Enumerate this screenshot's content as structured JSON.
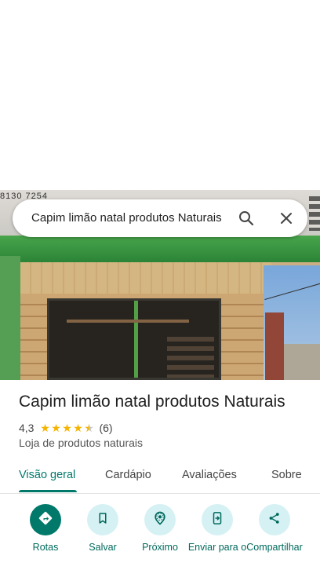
{
  "photo": {
    "sign_partial_text": "8130 7254"
  },
  "search": {
    "query": "Capim limão natal produtos Naturais"
  },
  "place": {
    "title": "Capim limão natal produtos Naturais",
    "rating": "4,3",
    "rating_value": 4.3,
    "rating_max": 5,
    "review_count": "(6)",
    "category": "Loja de produtos naturais"
  },
  "tabs": [
    {
      "label": "Visão geral",
      "active": true
    },
    {
      "label": "Cardápio"
    },
    {
      "label": "Avaliações"
    },
    {
      "label": "Sobre"
    }
  ],
  "actions": [
    {
      "label": "Rotas",
      "icon": "directions-icon"
    },
    {
      "label": "Salvar",
      "icon": "bookmark-icon"
    },
    {
      "label": "Próximo",
      "icon": "nearby-icon"
    },
    {
      "label": "Enviar para o",
      "icon": "send-to-phone-icon"
    },
    {
      "label": "Compartilhar",
      "icon": "share-icon"
    }
  ],
  "colors": {
    "accent": "#00796b",
    "action_bg": "#d6f1f4",
    "star": "#f5b400"
  }
}
